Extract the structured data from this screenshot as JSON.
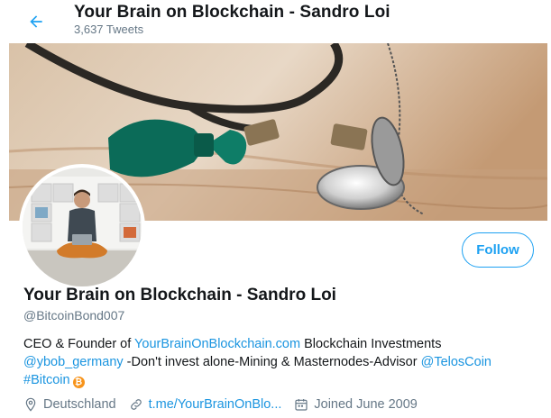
{
  "header": {
    "title": "Your Brain on Blockchain - Sandro Loi",
    "tweet_count": "3,637 Tweets",
    "back_icon": "arrow-left-icon"
  },
  "profile": {
    "name": "Your Brain on Blockchain - Sandro Loi",
    "handle": "@BitcoinBond007",
    "follow_label": "Follow",
    "bio": {
      "part1": "CEO & Founder of ",
      "link1": "YourBrainOnBlockchain.com",
      "part2": " Blockchain Investments",
      "mention1": "@ybob_germany",
      "part3": " -Don't invest alone-Mining & Masternodes-Advisor ",
      "mention2": "@TelosCoin",
      "hashtag": "#Bitcoin",
      "emoji": "bitcoin-icon"
    },
    "location": "Deutschland",
    "website": "t.me/YourBrainOnBlo...",
    "joined": "Joined June 2009"
  },
  "colors": {
    "accent": "#1da1f2",
    "link": "#1b95e0",
    "secondary_text": "#657786",
    "bitcoin": "#f7931a"
  }
}
